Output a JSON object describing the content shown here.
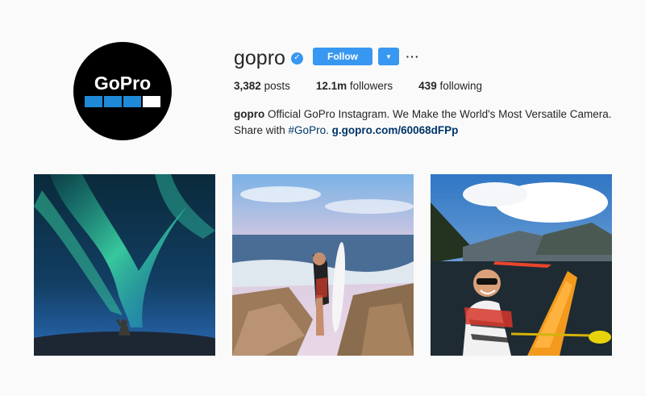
{
  "profile": {
    "avatar_logo_text": "GoPro",
    "username": "gopro",
    "verified_icon": "verified-badge-icon",
    "follow_label": "Follow",
    "dropdown_icon": "caret-down-icon",
    "more_icon": "more-options-icon"
  },
  "stats": [
    {
      "count": "3,382",
      "label": "posts"
    },
    {
      "count": "12.1m",
      "label": "followers"
    },
    {
      "count": "439",
      "label": "following"
    }
  ],
  "bio": {
    "name": "gopro",
    "text": " Official GoPro Instagram. We Make the World's Most Versatile Camera.",
    "line2_prefix": "Share with ",
    "hashtag": "#GoPro.",
    "link": "g.gopro.com/60068dFPp"
  },
  "posts": [
    {
      "subject": "aurora borealis over person"
    },
    {
      "subject": "surfer with surfboard at beach"
    },
    {
      "subject": "kayaker selfie in fjord"
    }
  ],
  "colors": {
    "accent": "#3897f0",
    "link": "#003569",
    "background": "#fafafa"
  }
}
